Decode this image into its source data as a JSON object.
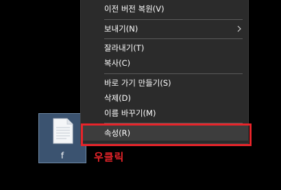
{
  "context_menu": {
    "items": [
      {
        "label": "이전 버전 복원(V)"
      },
      {
        "label": "보내기(N)",
        "submenu_icon": "chevron-right-icon"
      },
      {
        "label": "잘라내기(T)"
      },
      {
        "label": "복사(C)"
      },
      {
        "label": "바로 가기 만들기(S)"
      },
      {
        "label": "삭제(D)"
      },
      {
        "label": "이름 바꾸기(M)"
      },
      {
        "label": "속성(R)"
      }
    ]
  },
  "desktop": {
    "file_icon": "document-icon",
    "file_name": "f"
  },
  "annotation": {
    "text": "우클릭",
    "color": "#e8242a"
  }
}
